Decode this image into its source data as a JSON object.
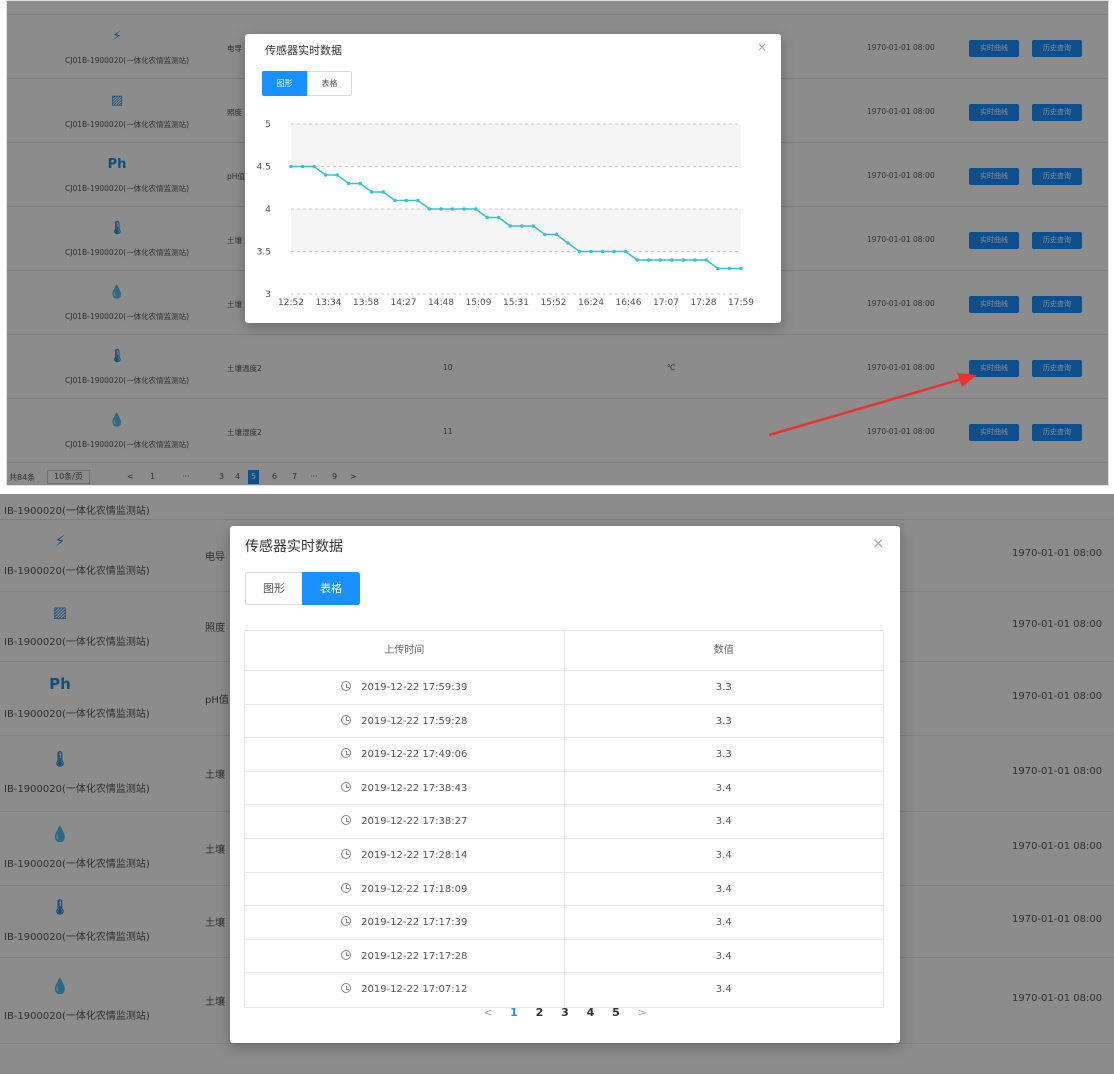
{
  "common": {
    "device_name": "CJ01B-1900020(一体化农情监测站)",
    "device_name_cropped": "IB-1900020(一体化农情监测站)",
    "time": "1970-01-01 08:00",
    "btn_realtime": "实时曲线",
    "btn_history": "历史查询"
  },
  "top_rows": [
    {
      "icon": "",
      "icon_name": "cropped-icon",
      "sensor": "",
      "value": "",
      "unit": ""
    },
    {
      "icon": "⚡",
      "icon_name": "conductivity-icon",
      "sensor": "电导",
      "value": "",
      "unit": ""
    },
    {
      "icon": "▨",
      "icon_name": "broken-image-icon",
      "sensor": "照度",
      "value": "",
      "unit": ""
    },
    {
      "icon": "Ph",
      "icon_name": "ph-icon",
      "sensor": "pH值",
      "value": "",
      "unit": ""
    },
    {
      "icon": "🌡",
      "icon_name": "soil-temperature-icon",
      "sensor": "土壤",
      "value": "",
      "unit": ""
    },
    {
      "icon": "💧",
      "icon_name": "soil-moisture-icon",
      "sensor": "土壤",
      "value": "",
      "unit": ""
    },
    {
      "icon": "🌡",
      "icon_name": "soil-temperature-icon",
      "sensor": "土壤温度2",
      "value": "10",
      "unit": "℃"
    },
    {
      "icon": "💧",
      "icon_name": "soil-moisture-icon",
      "sensor": "土壤湿度2",
      "value": "11",
      "unit": ""
    }
  ],
  "top_pager": {
    "total": "共84条",
    "page_size": "10条/页",
    "prev": "<",
    "p1": "1",
    "dots1": "···",
    "p3": "3",
    "p4": "4",
    "p5": "5",
    "p6": "6",
    "p7": "7",
    "dots2": "···",
    "p9": "9",
    "next": ">"
  },
  "modal_top": {
    "title": "传感器实时数据",
    "close": "×",
    "tab_graph": "图形",
    "tab_table": "表格",
    "active_tab": "graph"
  },
  "chart_data": {
    "type": "line",
    "title": "",
    "xlabel": "",
    "ylabel": "",
    "ylim": [
      3,
      5
    ],
    "yticks": [
      "3",
      "3.5",
      "4",
      "4.5",
      "5"
    ],
    "xticks": [
      "12:52",
      "13:34",
      "13:58",
      "14:27",
      "14:48",
      "15:09",
      "15:31",
      "15:52",
      "16:24",
      "16:46",
      "17:07",
      "17:28",
      "17:59"
    ],
    "grid": true,
    "series": [
      {
        "color": "#36c6c8",
        "values": [
          4.5,
          4.5,
          4.5,
          4.4,
          4.4,
          4.3,
          4.3,
          4.2,
          4.2,
          4.1,
          4.1,
          4.1,
          4.0,
          4.0,
          4.0,
          4.0,
          4.0,
          3.9,
          3.9,
          3.8,
          3.8,
          3.8,
          3.7,
          3.7,
          3.6,
          3.5,
          3.5,
          3.5,
          3.5,
          3.5,
          3.4,
          3.4,
          3.4,
          3.4,
          3.4,
          3.4,
          3.4,
          3.3,
          3.3,
          3.3
        ]
      }
    ]
  },
  "bottom_rows": [
    {
      "icon": "",
      "icon_name": "cropped-icon",
      "sensor": ""
    },
    {
      "icon": "⚡",
      "icon_name": "conductivity-icon",
      "sensor": "电导"
    },
    {
      "icon": "▨",
      "icon_name": "broken-image-icon",
      "sensor": "照度"
    },
    {
      "icon": "Ph",
      "icon_name": "ph-icon",
      "sensor": "pH值"
    },
    {
      "icon": "🌡",
      "icon_name": "soil-temperature-icon",
      "sensor": "土壤"
    },
    {
      "icon": "💧",
      "icon_name": "soil-moisture-icon",
      "sensor": "土壤"
    },
    {
      "icon": "🌡",
      "icon_name": "soil-temperature-icon",
      "sensor": "土壤"
    },
    {
      "icon": "💧",
      "icon_name": "soil-moisture-icon",
      "sensor": "土壤"
    }
  ],
  "modal_bottom": {
    "title": "传感器实时数据",
    "close": "×",
    "tab_graph": "图形",
    "tab_table": "表格",
    "active_tab": "table",
    "col_time": "上传时间",
    "col_value": "数值",
    "records": [
      {
        "time": "2019-12-22 17:59:39",
        "value": "3.3"
      },
      {
        "time": "2019-12-22 17:59:28",
        "value": "3.3"
      },
      {
        "time": "2019-12-22 17:49:06",
        "value": "3.3"
      },
      {
        "time": "2019-12-22 17:38:43",
        "value": "3.4"
      },
      {
        "time": "2019-12-22 17:38:27",
        "value": "3.4"
      },
      {
        "time": "2019-12-22 17:28:14",
        "value": "3.4"
      },
      {
        "time": "2019-12-22 17:18:09",
        "value": "3.4"
      },
      {
        "time": "2019-12-22 17:17:39",
        "value": "3.4"
      },
      {
        "time": "2019-12-22 17:17:28",
        "value": "3.4"
      },
      {
        "time": "2019-12-22 17:07:12",
        "value": "3.4"
      }
    ],
    "pager": {
      "prev": "<",
      "p1": "1",
      "p2": "2",
      "p3": "3",
      "p4": "4",
      "p5": "5",
      "next": ">"
    }
  }
}
